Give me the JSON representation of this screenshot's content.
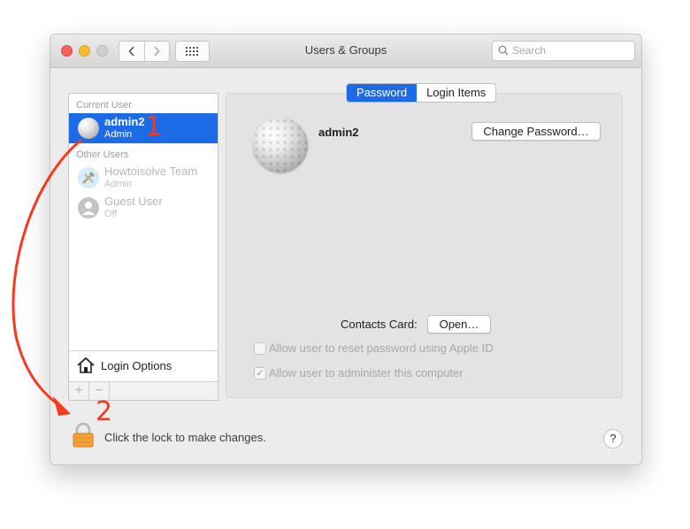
{
  "window": {
    "title": "Users & Groups"
  },
  "search": {
    "placeholder": "Search"
  },
  "sidebar": {
    "current_header": "Current User",
    "other_header": "Other Users",
    "users": [
      {
        "name": "admin2",
        "role": "Admin",
        "selected": true,
        "avatar": "golf-ball-avatar"
      },
      {
        "name": "Howtoisolve Team",
        "role": "Admin",
        "selected": false,
        "avatar": "tools-avatar"
      },
      {
        "name": "Guest User",
        "role": "Off",
        "selected": false,
        "avatar": "person-silhouette-avatar"
      }
    ],
    "login_options": "Login Options",
    "add_label": "+",
    "remove_label": "−"
  },
  "tabs": [
    {
      "label": "Password",
      "active": true
    },
    {
      "label": "Login Items",
      "active": false
    }
  ],
  "detail": {
    "user_name": "admin2",
    "change_password": "Change Password…",
    "contacts_label": "Contacts Card:",
    "open_button": "Open…",
    "checkbox_reset": {
      "label": "Allow user to reset password using Apple ID",
      "checked": false
    },
    "checkbox_admin": {
      "label": "Allow user to administer this computer",
      "checked": true
    }
  },
  "footer": {
    "lock_text": "Click the lock to make changes.",
    "help_label": "?"
  },
  "annotations": {
    "step1": "1",
    "step2": "2"
  },
  "colors": {
    "selection": "#1b6ae6",
    "annotation": "#f63a22"
  }
}
